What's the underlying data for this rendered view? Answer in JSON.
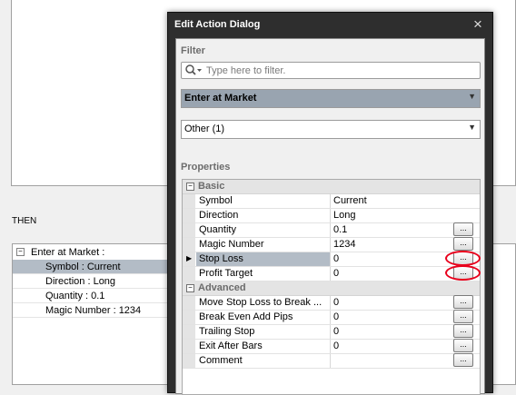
{
  "background": {
    "then_label": "THEN",
    "tree": {
      "expander": "−",
      "root": "Enter at Market :",
      "items": [
        {
          "text": "Symbol : Current",
          "selected": true
        },
        {
          "text": "Direction : Long",
          "selected": false
        },
        {
          "text": "Quantity : 0.1",
          "selected": false
        },
        {
          "text": "Magic Number : 1234",
          "selected": false
        }
      ]
    }
  },
  "dialog": {
    "title": "Edit Action Dialog",
    "close_icon": "×",
    "filter_label": "Filter",
    "filter_placeholder": "Type here to filter.",
    "action_value": "Enter at Market",
    "category_value": "Other (1)",
    "properties_label": "Properties",
    "ellipsis": "...",
    "groups": {
      "basic": {
        "label": "Basic",
        "rows": [
          {
            "name": "Symbol",
            "value": "Current"
          },
          {
            "name": "Direction",
            "value": "Long"
          },
          {
            "name": "Quantity",
            "value": "0.1"
          },
          {
            "name": "Magic Number",
            "value": "1234"
          },
          {
            "name": "Stop Loss",
            "value": "0"
          },
          {
            "name": "Profit Target",
            "value": "0"
          }
        ]
      },
      "advanced": {
        "label": "Advanced",
        "rows": [
          {
            "name": "Move Stop Loss to Break ...",
            "value": "0"
          },
          {
            "name": "Break Even Add Pips",
            "value": "0"
          },
          {
            "name": "Trailing Stop",
            "value": "0"
          },
          {
            "name": "Exit After Bars",
            "value": "0"
          },
          {
            "name": "Comment",
            "value": ""
          }
        ]
      }
    }
  },
  "colors": {
    "titlebar": "#2e2e2e",
    "selection": "#b3bcc6",
    "highlight_ring": "#e8001c"
  }
}
